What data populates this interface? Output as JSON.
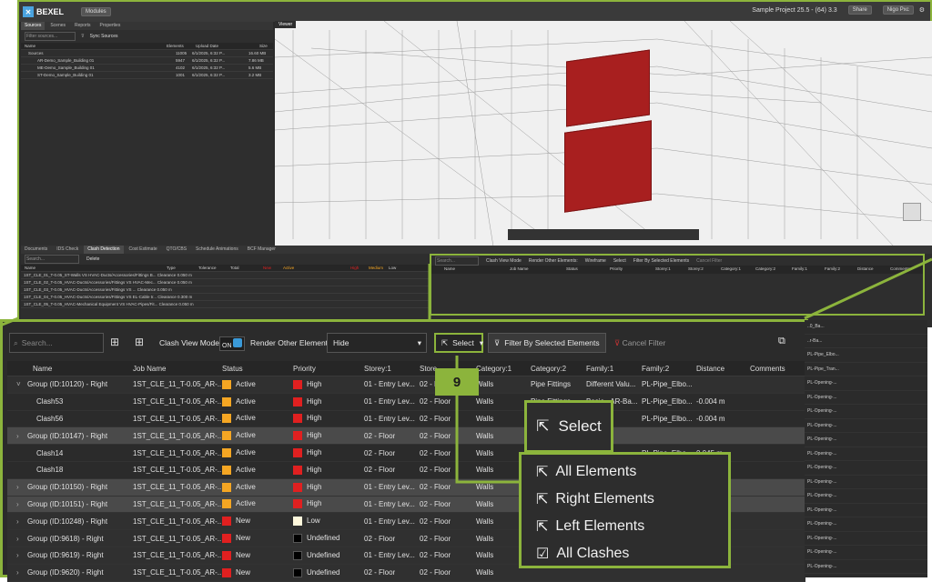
{
  "app": {
    "brand": "BEXEL",
    "modules_label": "Modules",
    "project": "Sample Project 25.5 - (64) 3.3",
    "share": "Share",
    "user": "Nigo Pxc"
  },
  "left_tabs": [
    "Sources",
    "Scenes",
    "Reports",
    "Properties"
  ],
  "sources": {
    "filter_placeholder": "Filter sources...",
    "sync": "Sync Sources",
    "headers": [
      "Name",
      "Elements",
      "Upload Date",
      "Size"
    ],
    "rows": [
      {
        "name": "Sources",
        "elements": "11005",
        "date": "6/1/2025, 6:32 P...",
        "size": "16.60 MB"
      },
      {
        "name": "AR-Demo_Sample_Building 01",
        "elements": "5947",
        "date": "6/1/2025, 6:32 P...",
        "size": "7.86 MB"
      },
      {
        "name": "ME-Demo_Sample_Building 01",
        "elements": "4102",
        "date": "6/1/2025, 6:32 P...",
        "size": "5.6 MB"
      },
      {
        "name": "ST-Demo_Sample_Building 01",
        "elements": "1001",
        "date": "6/1/2025, 6:32 P...",
        "size": "3.2 MB"
      }
    ]
  },
  "viewer_tab": "Viewer",
  "bottom_tabs": [
    "Documents",
    "IDS Check",
    "Clash Detection",
    "Cost Estimate",
    "QTO/CBS",
    "Schedule Animations",
    "BCF Manager"
  ],
  "mini_table": {
    "search": "Search...",
    "delete": "Delete",
    "headers": [
      "Name",
      "Type",
      "Tolerance",
      "Total",
      "New",
      "Active",
      "",
      "",
      "",
      "High",
      "Medium",
      "Low"
    ],
    "rows": [
      "1ST_CLE_01_T-0.05_ST-Walls VS HVAC-Ducts/Accessories/Fittings B... Clearance 0.050 m",
      "1ST_CLE_02_T-0.05_HVAC-Ducts/Accessories/Fittings VS HVAC-Mec... Clearance 0.050 m",
      "1ST_CLE_03_T-0.05_HVAC-Ducts/Accessories/Fittings VS ... Clearance 0.050 m",
      "1ST_CLE_04_T-0.05_HVAC-Ducts/Accessories/Fittings VS EL-Cable tr... Clearance 0.300 m",
      "1ST_CLE_05_T-0.05_HVAC-Mechanical Equipment VS HVAC-Pipes/Fit... Clearance 0.050 m"
    ]
  },
  "small_right": {
    "search": "Search...",
    "clash_view": "Clash View Mode",
    "render_other": "Render Other Elements:",
    "render_value": "Wireframe",
    "select": "Select",
    "filter": "Filter By Selected Elements",
    "cancel": "Cancel Filter",
    "headers": [
      "Name",
      "Job Name",
      "Status",
      "Priority",
      "Storey:1",
      "Storey:2",
      "Category:1",
      "Category:2",
      "Family:1",
      "Family:2",
      "Distance",
      "Comments"
    ]
  },
  "toolbar": {
    "search_placeholder": "Search...",
    "clash_view_mode": "Clash View Mode",
    "on": "ON",
    "render_other": "Render Other Elements:",
    "render_value": "Hide",
    "select": "Select",
    "filter": "Filter By Selected Elements",
    "cancel": "Cancel Filter"
  },
  "table": {
    "headers": [
      "Name",
      "Job Name",
      "Status",
      "Priority",
      "Storey:1",
      "Store",
      "Category:1",
      "Category:2",
      "Family:1",
      "Family:2",
      "Distance",
      "Comments"
    ],
    "rows": [
      {
        "name": "Group (ID:10120) - Right",
        "job": "1ST_CLE_11_T-0.05_AR-...",
        "status": "Active",
        "priority": "High",
        "storey": "01 - Entry Lev...",
        "store": "02 - Floor",
        "cat1": "Walls",
        "cat2": "Pipe Fittings",
        "fam1": "Different Valu...",
        "fam2": "PL-Pipe_Elbo...",
        "dist": "",
        "type": "group"
      },
      {
        "name": "Clash53",
        "job": "1ST_CLE_11_T-0.05_AR-...",
        "status": "Active",
        "priority": "High",
        "storey": "01 - Entry Lev...",
        "store": "02 - Floor",
        "cat1": "Walls",
        "cat2": "Pipe Fittings",
        "fam1": "Basic - AR-Ba...",
        "fam2": "PL-Pipe_Elbo...",
        "dist": "-0.004 m",
        "type": "child"
      },
      {
        "name": "Clash56",
        "job": "1ST_CLE_11_T-0.05_AR-...",
        "status": "Active",
        "priority": "High",
        "storey": "01 - Entry Lev...",
        "store": "02 - Floor",
        "cat1": "Walls",
        "cat2": "",
        "fam1": "",
        "fam2": "PL-Pipe_Elbo...",
        "dist": "-0.004 m",
        "type": "child"
      },
      {
        "name": "Group (ID:10147) - Right",
        "job": "1ST_CLE_11_T-0.05_AR-...",
        "status": "Active",
        "priority": "High",
        "storey": "02 - Floor",
        "store": "02 - Floor",
        "cat1": "Walls",
        "cat2": "",
        "fam1": "",
        "fam2": "",
        "dist": "",
        "type": "group-hl"
      },
      {
        "name": "Clash14",
        "job": "1ST_CLE_11_T-0.05_AR-...",
        "status": "Active",
        "priority": "High",
        "storey": "02 - Floor",
        "store": "02 - Floor",
        "cat1": "Walls",
        "cat2": "",
        "fam1": "Ba...",
        "fam2": "PL-Pipe_Elbo...",
        "dist": "0.045 m",
        "type": "child"
      },
      {
        "name": "Clash18",
        "job": "1ST_CLE_11_T-0.05_AR-...",
        "status": "Active",
        "priority": "High",
        "storey": "02 - Floor",
        "store": "02 - Floor",
        "cat1": "Walls",
        "cat2": "",
        "fam1": "Ba...",
        "fam2": "",
        "dist": "",
        "type": "child"
      },
      {
        "name": "Group (ID:10150) - Right",
        "job": "1ST_CLE_11_T-0.05_AR-...",
        "status": "Active",
        "priority": "High",
        "storey": "01 - Entry Lev...",
        "store": "02 - Floor",
        "cat1": "Walls",
        "cat2": "",
        "fam1": "Ba...",
        "fam2": "",
        "dist": "",
        "type": "group-hl"
      },
      {
        "name": "Group (ID:10151) - Right",
        "job": "1ST_CLE_11_T-0.05_AR-...",
        "status": "Active",
        "priority": "High",
        "storey": "01 - Entry Lev...",
        "store": "02 - Floor",
        "cat1": "Walls",
        "cat2": "",
        "fam1": "Ba...",
        "fam2": "",
        "dist": "",
        "type": "group-hl"
      },
      {
        "name": "Group (ID:10248) - Right",
        "job": "1ST_CLE_11_T-0.05_AR-...",
        "status": "New",
        "priority": "Low",
        "storey": "01 - Entry Lev...",
        "store": "02 - Floor",
        "cat1": "Walls",
        "cat2": "",
        "fam1": "",
        "fam2": "",
        "dist": "",
        "type": "group"
      },
      {
        "name": "Group (ID:9618) - Right",
        "job": "1ST_CLE_11_T-0.05_AR-...",
        "status": "New",
        "priority": "Undefined",
        "storey": "02 - Floor",
        "store": "02 - Floor",
        "cat1": "Walls",
        "cat2": "",
        "fam1": "",
        "fam2": "",
        "dist": "",
        "type": "group"
      },
      {
        "name": "Group (ID:9619) - Right",
        "job": "1ST_CLE_11_T-0.05_AR-...",
        "status": "New",
        "priority": "Undefined",
        "storey": "01 - Entry Lev...",
        "store": "02 - Floor",
        "cat1": "Walls",
        "cat2": "",
        "fam1": "",
        "fam2": "",
        "dist": "",
        "type": "group"
      },
      {
        "name": "Group (ID:9620) - Right",
        "job": "1ST_CLE_11_T-0.05_AR-...",
        "status": "New",
        "priority": "Undefined",
        "storey": "02 - Floor",
        "store": "02 - Floor",
        "cat1": "Walls",
        "cat2": "",
        "fam1": "",
        "fam2": "",
        "dist": "",
        "type": "group"
      }
    ]
  },
  "right_ext_rows": [
    "..0_Ba...",
    "..r-Ba...",
    "PL-Pipe_Elbo...",
    "PL-Pipe_Tran...",
    "PL-Opening-...",
    "PL-Opening-...",
    "PL-Opening-...",
    "PL-Opening-...",
    "PL-Opening-...",
    "PL-Opening-...",
    "PL-Opening-...",
    "PL-Opening-...",
    "PL-Opening-...",
    "PL-Opening-...",
    "PL-Opening-...",
    "PL-Opening-...",
    "PL-Opening-...",
    "PL-Opening-..."
  ],
  "callout": "9",
  "dropdown": {
    "select": "Select",
    "items": [
      "All Elements",
      "Right Elements",
      "Left Elements",
      "All Clashes"
    ]
  },
  "colors": {
    "accent": "#8cb43c",
    "active": "#f5a623",
    "high": "#e02020",
    "new": "#e02020",
    "low": "#fff8dc",
    "undefined": "#000000"
  }
}
